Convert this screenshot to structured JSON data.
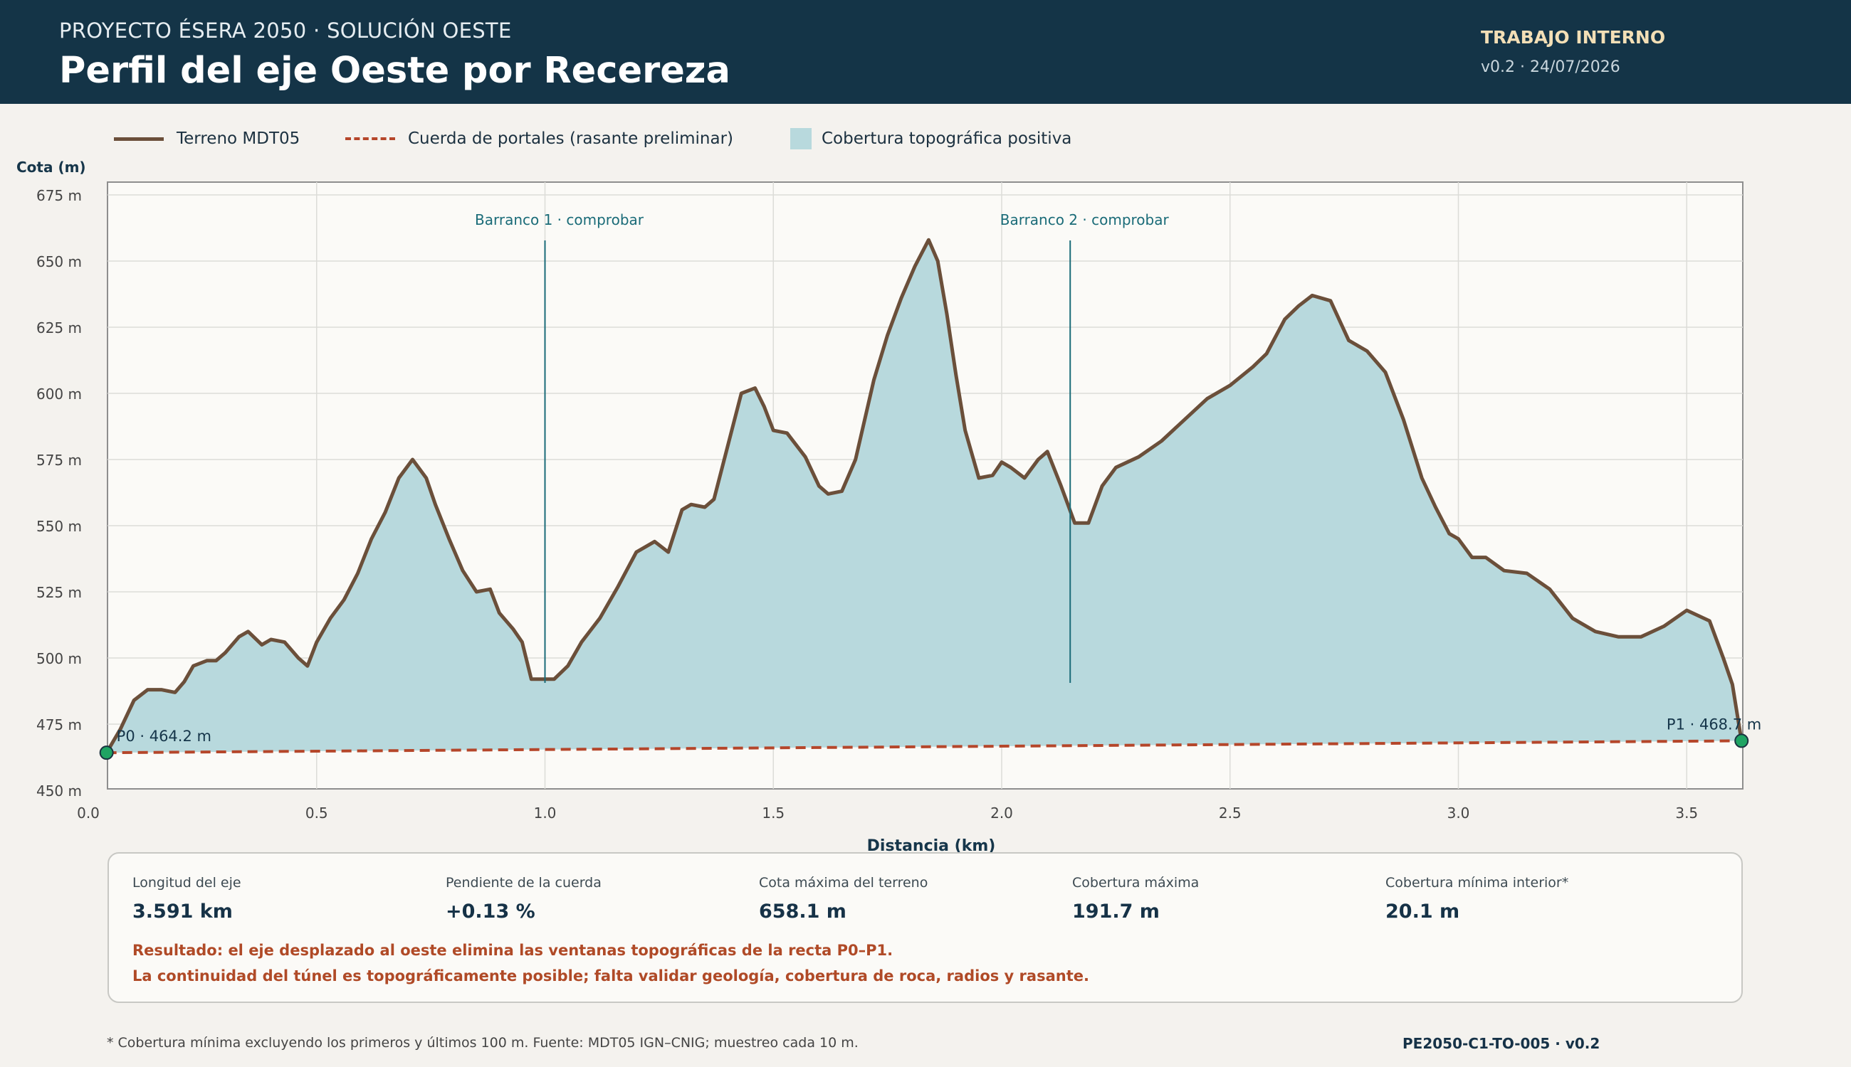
{
  "header": {
    "eyebrow": "PROYECTO ÉSERA 2050 · SOLUCIÓN OESTE",
    "title": "Perfil del eje Oeste por Recereza",
    "badge": "TRABAJO INTERNO",
    "version": "v0.2 · 24/07/2026"
  },
  "legend": {
    "terrain": "Terreno MDT05",
    "chord": "Cuerda de portales (rasante preliminar)",
    "cover": "Cobertura topográfica positiva"
  },
  "colors": {
    "terrain": "#6b4f3a",
    "chord": "#b5462a",
    "cover": "#b8d9dd",
    "annotation": "#1a6b78",
    "portal": "#1fa463"
  },
  "chart_data": {
    "type": "area",
    "xlabel": "Distancia (km)",
    "ylabel": "Cota (m)",
    "xlim": [
      0.0,
      3.62
    ],
    "ylim": [
      450,
      675
    ],
    "xticks": [
      0.0,
      0.5,
      1.0,
      1.5,
      2.0,
      2.5,
      3.0,
      3.5
    ],
    "xtick_labels": [
      "0.0",
      "0.5",
      "1.0",
      "1.5",
      "2.0",
      "2.5",
      "3.0",
      "3.5"
    ],
    "yticks": [
      450,
      475,
      500,
      525,
      550,
      575,
      600,
      625,
      650,
      675
    ],
    "ytick_labels": [
      "450 m",
      "475 m",
      "500 m",
      "525 m",
      "550 m",
      "575 m",
      "600 m",
      "625 m",
      "650 m",
      "675 m"
    ],
    "grid": true,
    "legend_position": "top-left",
    "series": [
      {
        "name": "Terreno MDT05",
        "x": [
          0.04,
          0.07,
          0.1,
          0.13,
          0.16,
          0.19,
          0.21,
          0.23,
          0.26,
          0.28,
          0.3,
          0.33,
          0.35,
          0.38,
          0.4,
          0.43,
          0.46,
          0.48,
          0.5,
          0.53,
          0.56,
          0.59,
          0.62,
          0.65,
          0.68,
          0.71,
          0.74,
          0.76,
          0.79,
          0.82,
          0.85,
          0.88,
          0.9,
          0.93,
          0.95,
          0.97,
          1.0,
          1.02,
          1.05,
          1.08,
          1.12,
          1.16,
          1.2,
          1.24,
          1.27,
          1.3,
          1.32,
          1.35,
          1.37,
          1.4,
          1.43,
          1.46,
          1.48,
          1.5,
          1.53,
          1.57,
          1.6,
          1.62,
          1.65,
          1.68,
          1.72,
          1.75,
          1.78,
          1.81,
          1.84,
          1.86,
          1.88,
          1.9,
          1.92,
          1.95,
          1.98,
          2.0,
          2.02,
          2.05,
          2.08,
          2.1,
          2.13,
          2.16,
          2.19,
          2.22,
          2.25,
          2.3,
          2.35,
          2.4,
          2.45,
          2.5,
          2.55,
          2.58,
          2.62,
          2.65,
          2.68,
          2.72,
          2.76,
          2.8,
          2.84,
          2.88,
          2.92,
          2.95,
          2.98,
          3.0,
          3.03,
          3.06,
          3.1,
          3.15,
          3.2,
          3.25,
          3.3,
          3.35,
          3.4,
          3.45,
          3.5,
          3.55,
          3.58,
          3.6,
          3.62
        ],
        "values": [
          464.2,
          473,
          484,
          488,
          488,
          487,
          491,
          497,
          499,
          499,
          502,
          508,
          510,
          505,
          507,
          506,
          500,
          497,
          506,
          515,
          522,
          532,
          545,
          555,
          568,
          575,
          568,
          558,
          545,
          533,
          525,
          526,
          517,
          511,
          506,
          492,
          492,
          492,
          497,
          506,
          515,
          527,
          540,
          544,
          540,
          556,
          558,
          557,
          560,
          580,
          600,
          602,
          595,
          586,
          585,
          576,
          565,
          562,
          563,
          575,
          605,
          622,
          636,
          648,
          658,
          650,
          630,
          607,
          586,
          568,
          569,
          574,
          572,
          568,
          575,
          578,
          565,
          551,
          551,
          565,
          572,
          576,
          582,
          590,
          598,
          603,
          610,
          615,
          628,
          633,
          637,
          635,
          620,
          616,
          608,
          590,
          568,
          557,
          547,
          545,
          538,
          538,
          533,
          532,
          526,
          515,
          510,
          508,
          508,
          512,
          518,
          514,
          500,
          490,
          468.7
        ]
      },
      {
        "name": "Cuerda de portales (rasante preliminar)",
        "x": [
          0.04,
          3.62
        ],
        "values": [
          464.2,
          468.7
        ]
      }
    ],
    "annotations": [
      {
        "label": "Barranco 1 · comprobar",
        "x": 1.0
      },
      {
        "label": "Barranco 2 · comprobar",
        "x": 2.15
      }
    ],
    "portals": [
      {
        "label": "P0 · 464.2 m",
        "x": 0.04,
        "y": 464.2
      },
      {
        "label": "P1 · 468.7 m",
        "x": 3.62,
        "y": 468.7
      }
    ]
  },
  "stats": [
    {
      "label": "Longitud del eje",
      "value": "3.591 km"
    },
    {
      "label": "Pendiente de la cuerda",
      "value": "+0.13 %"
    },
    {
      "label": "Cota máxima del terreno",
      "value": "658.1 m"
    },
    {
      "label": "Cobertura máxima",
      "value": "191.7 m"
    },
    {
      "label": "Cobertura mínima interior*",
      "value": "20.1 m"
    }
  ],
  "result": {
    "line1": "Resultado: el eje desplazado al oeste elimina las ventanas topográficas de la recta P0–P1.",
    "line2": "La continuidad del túnel es topográficamente posible; falta validar geología, cobertura de roca, radios y rasante."
  },
  "footer": {
    "note": "* Cobertura mínima excluyendo los primeros y últimos 100 m. Fuente: MDT05 IGN–CNIG; muestreo cada 10 m.",
    "doc": "PE2050-C1-TO-005 · v0.2"
  }
}
